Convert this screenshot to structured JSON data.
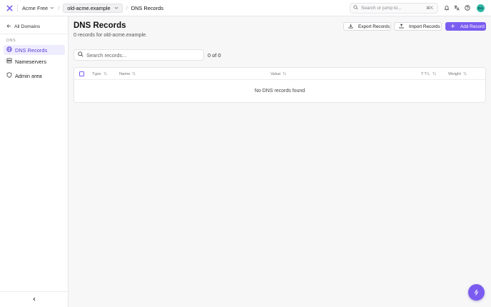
{
  "theme": {
    "accent": "#7b5cf0",
    "avatar_bg": "#2fb7a6"
  },
  "topbar": {
    "org": "Acme Free",
    "project": "old-acme.example",
    "page": "DNS Records",
    "search_placeholder": "Search or jump to...",
    "shortcut": "⌘K",
    "avatar_initials": "DA",
    "icons": [
      "bell-icon",
      "translate-icon",
      "help-icon"
    ]
  },
  "sidebar": {
    "back_label": "All Domains",
    "section": "DNS",
    "items": [
      {
        "label": "DNS Records",
        "icon": "globe-icon",
        "active": true
      },
      {
        "label": "Nameservers",
        "icon": "server-icon",
        "active": false
      },
      {
        "label": "Admin area",
        "icon": "shield-icon",
        "active": false
      }
    ]
  },
  "main": {
    "title": "DNS Records",
    "subtitle": "0 records for old-acme.example.",
    "buttons": {
      "export": "Export Records",
      "import": "Import Records",
      "add": "Add Record"
    },
    "filter_placeholder": "Search records...",
    "count": "0 of 0",
    "table": {
      "columns": [
        "Type",
        "Name",
        "Value",
        "TTL",
        "Weight"
      ],
      "empty_text": "No DNS records found"
    }
  }
}
